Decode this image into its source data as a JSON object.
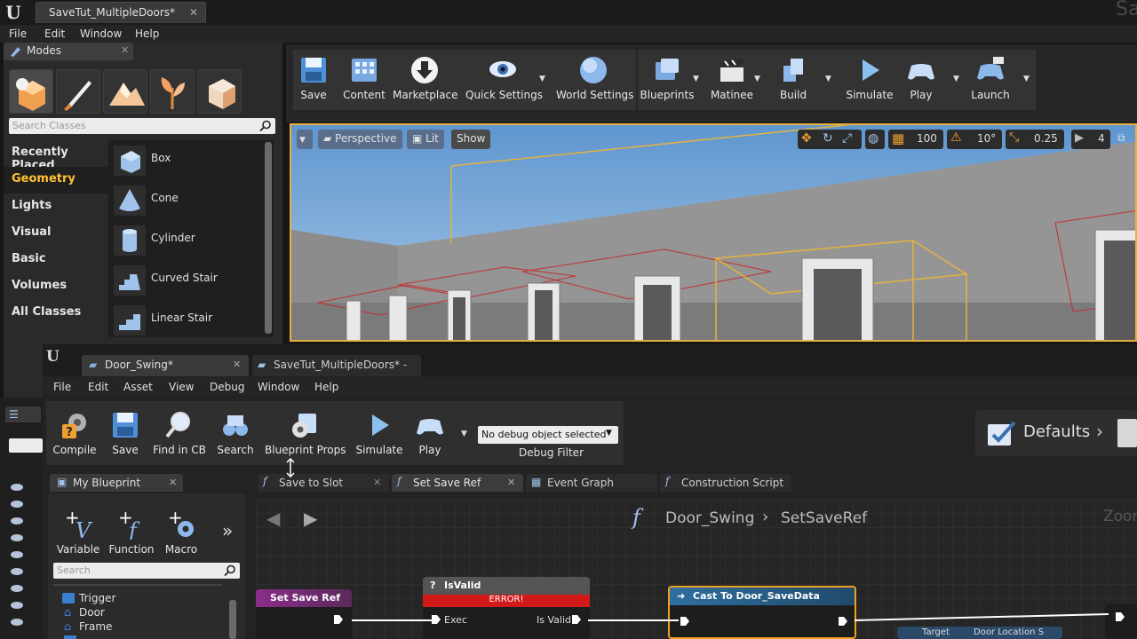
{
  "main": {
    "tab_title": "SaveTut_MultipleDoors*",
    "corner_label": "Sa",
    "menu": [
      "File",
      "Edit",
      "Window",
      "Help"
    ]
  },
  "modes": {
    "tab_label": "Modes",
    "search_placeholder": "Search Classes",
    "categories": [
      "Recently Placed",
      "Geometry",
      "Lights",
      "Visual",
      "Basic",
      "Volumes",
      "All Classes"
    ],
    "selected_category": "Geometry",
    "classes": [
      "Box",
      "Cone",
      "Cylinder",
      "Curved Stair",
      "Linear Stair"
    ]
  },
  "level_toolbar": {
    "buttons": [
      "Save",
      "Content",
      "Marketplace",
      "Quick Settings",
      "World Settings",
      "Blueprints",
      "Matinee",
      "Build",
      "Simulate",
      "Play",
      "Launch"
    ]
  },
  "viewport": {
    "perspective": "Perspective",
    "lit": "Lit",
    "show": "Show",
    "grid_snap": "100",
    "rot_snap": "10°",
    "scale_snap": "0.25",
    "camera_speed": "4"
  },
  "bp_editor": {
    "tabs": [
      "Door_Swing*",
      "SaveTut_MultipleDoors* -"
    ],
    "menu": [
      "File",
      "Edit",
      "Asset",
      "View",
      "Debug",
      "Window",
      "Help"
    ],
    "toolbar": [
      "Compile",
      "Save",
      "Find in CB",
      "Search",
      "Blueprint Props",
      "Simulate",
      "Play"
    ],
    "debug_selected": "No debug object selected",
    "debug_filter": "Debug Filter",
    "defaults": "Defaults",
    "mybp_tab": "My Blueprint",
    "mybp_buttons": [
      "Variable",
      "Function",
      "Macro"
    ],
    "search_placeholder": "Search",
    "tree": [
      "Trigger",
      "Door",
      "Frame"
    ],
    "graph_tabs": [
      "Save to Slot",
      "Set Save Ref",
      "Event Graph",
      "Construction Script"
    ],
    "breadcrumb_bp": "Door_Swing",
    "breadcrumb_fn": "SetSaveRef",
    "zoom_label": "Zoom",
    "nodes": {
      "entry": "Set Save Ref",
      "isvalid": "IsValid",
      "error": "ERROR!",
      "exec": "Exec",
      "isvalid_out": "Is Valid",
      "cast": "Cast To Door_SaveData",
      "target": "Target",
      "door_location": "Door Location S"
    }
  },
  "colors": {
    "accent": "#ffc233",
    "viewport_border": "#e6b23d",
    "error": "#d11919",
    "cast_head": "#2f6fa0",
    "function_head": "#8a2d8a"
  }
}
